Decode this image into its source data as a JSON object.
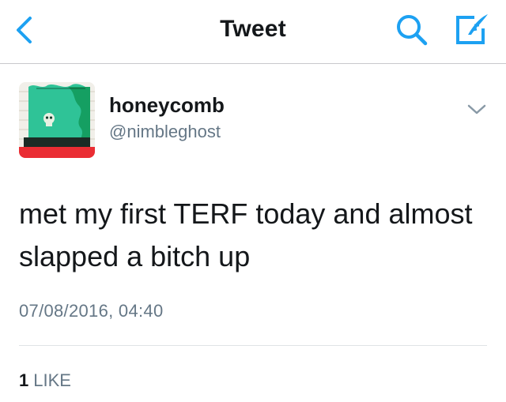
{
  "nav": {
    "title": "Tweet",
    "accent_color": "#1da1f2",
    "icons": [
      "chevron-left-icon",
      "search-icon",
      "compose-icon"
    ]
  },
  "tweet": {
    "display_name": "honeycomb",
    "username": "@nimbleghost",
    "text": "met my first TERF today and almost slapped a bitch up",
    "timestamp": "07/08/2016, 04:40",
    "likes": {
      "count": "1",
      "label": "LIKE"
    }
  },
  "colors": {
    "primary_text": "#14171a",
    "secondary_text": "#657786",
    "divider": "#dfe3e6"
  }
}
